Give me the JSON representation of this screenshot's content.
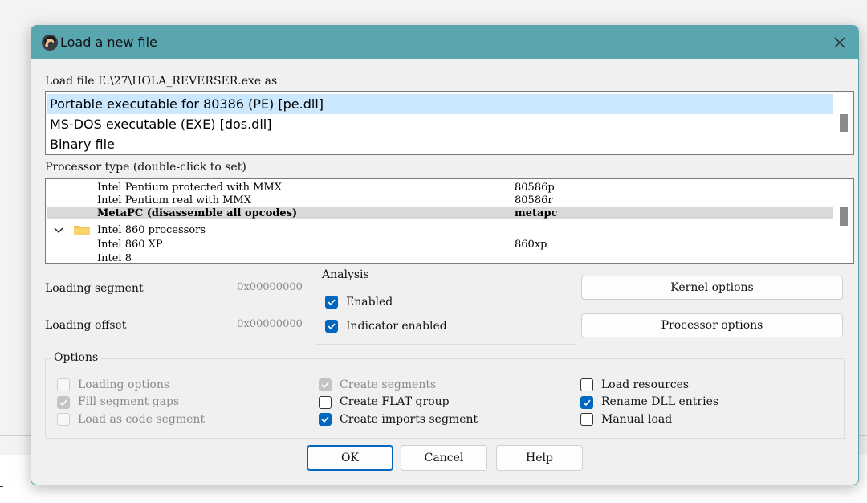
{
  "dialog": {
    "title": "Load a new file",
    "load_file_label": "Load file E:\\27\\HOLA_REVERSER.exe as",
    "file_types": [
      {
        "label": "Portable executable for 80386 (PE) [pe.dll]",
        "selected": true
      },
      {
        "label": "MS-DOS executable (EXE) [dos.dll]",
        "selected": false
      },
      {
        "label": "Binary file",
        "selected": false
      }
    ],
    "processor_label": "Processor type (double-click to set)",
    "processors": [
      {
        "name": "Intel Pentium protected with MMX",
        "code": "80586p"
      },
      {
        "name": "Intel Pentium real with MMX",
        "code": "80586r"
      },
      {
        "name": "MetaPC (disassemble all opcodes)",
        "code": "metapc",
        "selected": true
      },
      {
        "name": "Intel 860 processors",
        "code": "",
        "group": true
      },
      {
        "name": "Intel 860 XP",
        "code": "860xp"
      }
    ],
    "loading_segment": {
      "label": "Loading segment",
      "value": "0x00000000"
    },
    "loading_offset": {
      "label": "Loading offset",
      "value": "0x00000000"
    },
    "analysis": {
      "title": "Analysis",
      "enabled": {
        "label": "Enabled",
        "checked": true
      },
      "indicator": {
        "label": "Indicator enabled",
        "checked": true
      }
    },
    "kernel_options_label": "Kernel options",
    "processor_options_label": "Processor options",
    "options": {
      "title": "Options",
      "loading_options": {
        "label": "Loading options",
        "checked": false,
        "disabled": true
      },
      "fill_segment_gaps": {
        "label": "Fill segment gaps",
        "checked": true,
        "disabled": true
      },
      "load_as_code_segment": {
        "label": "Load as code segment",
        "checked": false,
        "disabled": true
      },
      "create_segments": {
        "label": "Create segments",
        "checked": true,
        "disabled": true
      },
      "create_flat_group": {
        "label": "Create FLAT group",
        "checked": false,
        "disabled": false
      },
      "create_imports_segment": {
        "label": "Create imports segment",
        "checked": true,
        "disabled": false
      },
      "load_resources": {
        "label": "Load resources",
        "checked": false,
        "disabled": false
      },
      "rename_dll_entries": {
        "label": "Rename DLL entries",
        "checked": true,
        "disabled": false
      },
      "manual_load": {
        "label": "Manual load",
        "checked": false,
        "disabled": false
      }
    },
    "buttons": {
      "ok": "OK",
      "cancel": "Cancel",
      "help": "Help"
    }
  },
  "colors": {
    "titlebar": "#5aa6b0",
    "accent": "#0067c0",
    "selection": "#cce8ff"
  },
  "icons": {
    "app": "ida-icon",
    "close": "close-icon",
    "folder": "folder-icon",
    "expand": "chevron-down-icon"
  }
}
